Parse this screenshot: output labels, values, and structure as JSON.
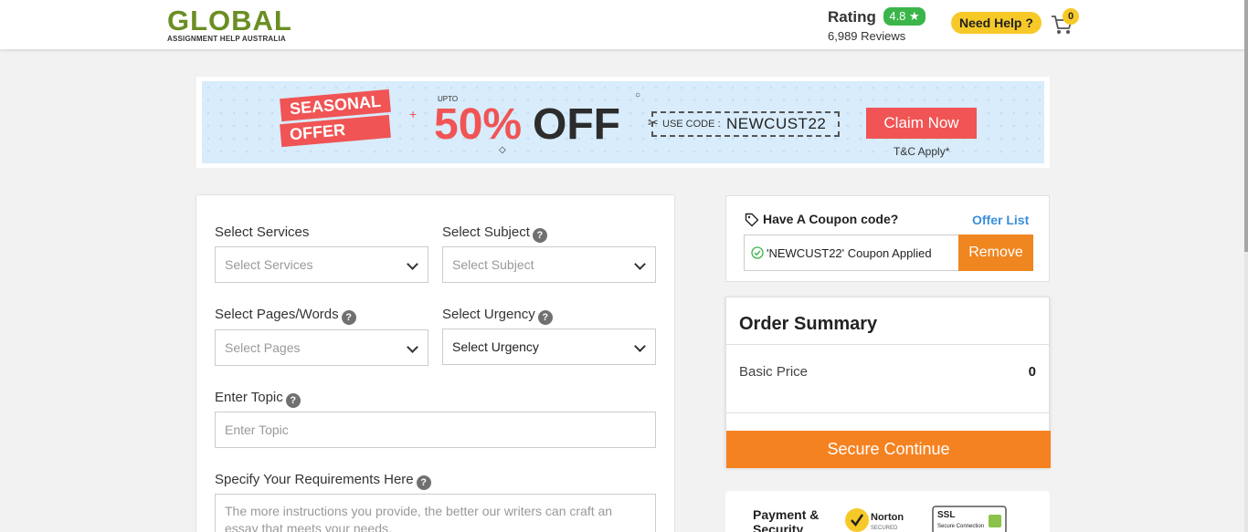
{
  "header": {
    "logo_word": "GLOBAL",
    "logo_sub": "ASSIGNMENT HELP AUSTRALIA",
    "rating_label": "Rating",
    "rating_value": "4.8",
    "reviews": "6,989 Reviews",
    "need_help": "Need Help ?",
    "cart_count": "0"
  },
  "banner": {
    "seasonal": "SEASONAL",
    "offer": "OFFER",
    "upto": "UPTO",
    "percent": "50%",
    "off": "OFF",
    "use_code": "USE CODE :",
    "code": "NEWCUST22",
    "claim": "Claim Now",
    "tc": "T&C Apply*"
  },
  "form": {
    "services_label": "Select Services",
    "services_value": "Select Services",
    "subject_label": "Select Subject",
    "subject_value": "Select Subject",
    "pages_label": "Select Pages/Words",
    "pages_value": "Select Pages",
    "urgency_label": "Select Urgency",
    "urgency_value": "Select Urgency",
    "topic_label": "Enter Topic",
    "topic_placeholder": "Enter Topic",
    "requirements_label": "Specify Your Requirements Here",
    "requirements_placeholder": "The more instructions you provide, the better our writers can craft an essay that meets your needs."
  },
  "coupon": {
    "title": "Have A Coupon code?",
    "offer_list": "Offer List",
    "applied": "'NEWCUST22' Coupon Applied",
    "remove": "Remove"
  },
  "summary": {
    "title": "Order Summary",
    "basic_price_label": "Basic Price",
    "basic_price_value": "0",
    "secure_continue": "Secure Continue"
  },
  "payment": {
    "label": "Payment & Security",
    "norton": "Norton",
    "norton_sub": "SECURED",
    "ssl": "SSL",
    "ssl_sub": "Secure Connection"
  },
  "colors": {
    "accent_orange": "#f58220",
    "offer_red": "#f05454",
    "help_yellow": "#f7c928",
    "rating_green": "#3bb54a",
    "link_blue": "#3a8fd9"
  }
}
